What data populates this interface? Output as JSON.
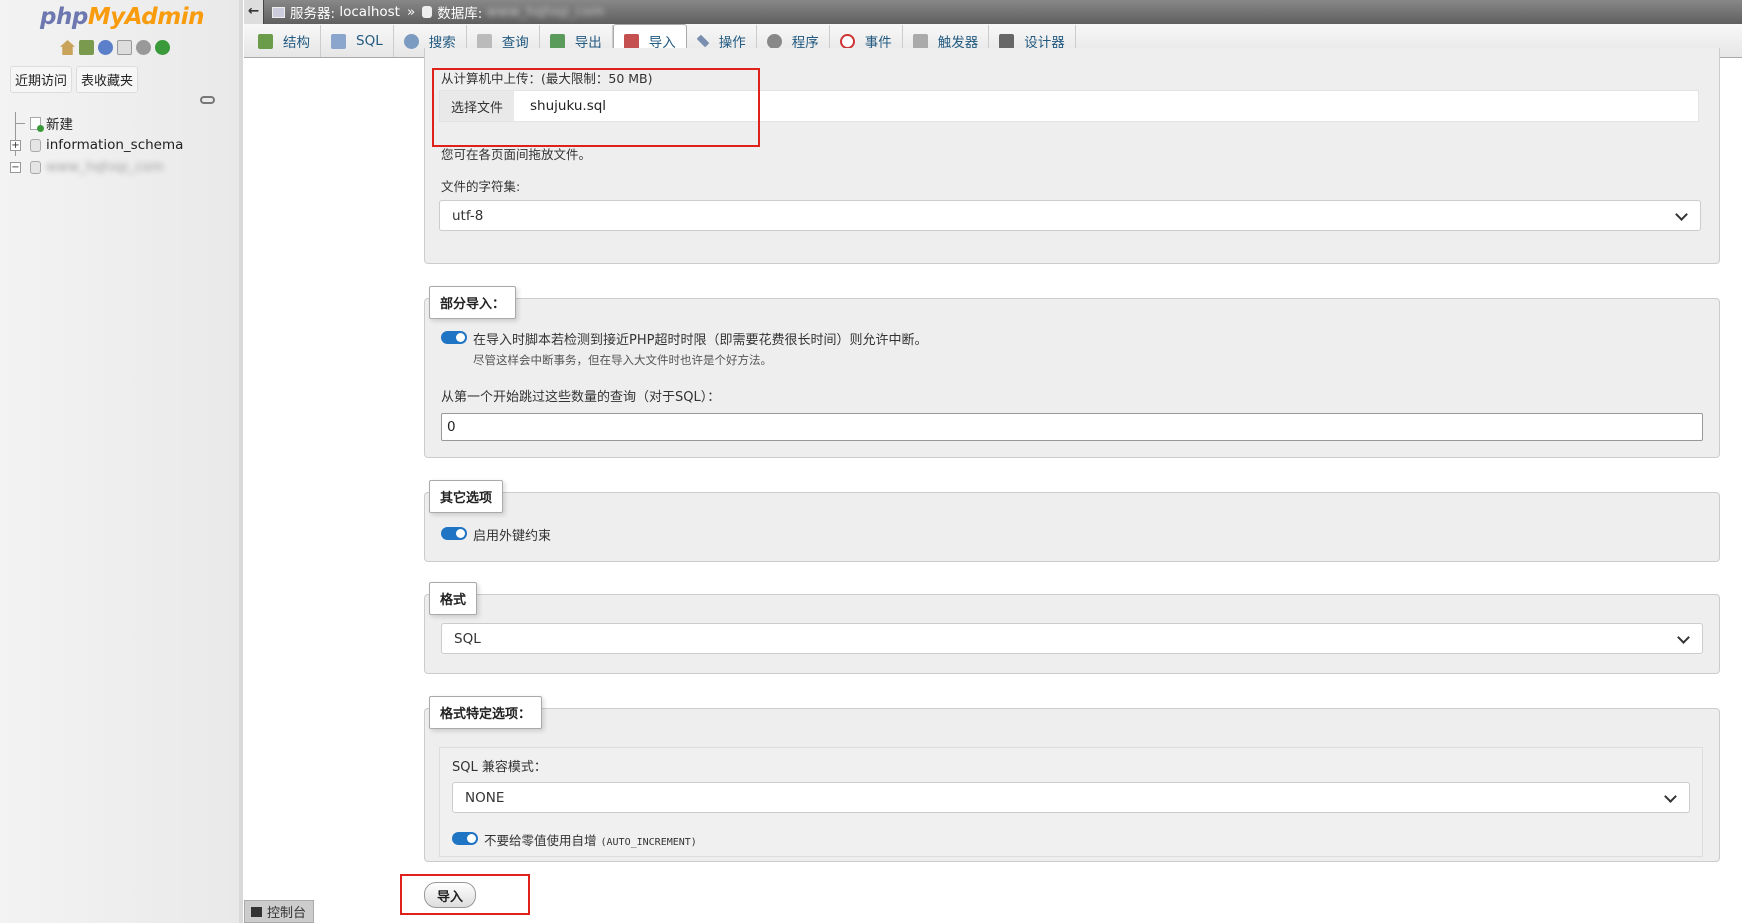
{
  "app": {
    "logo_php": "php",
    "logo_myadmin": "MyAdmin"
  },
  "nav": {
    "tabs": [
      "近期访问",
      "表收藏夹"
    ],
    "tree": [
      {
        "label": "新建"
      },
      {
        "label": "information_schema"
      },
      {
        "label": "www_hqhxp_com"
      }
    ]
  },
  "breadcrumb": {
    "server_label": "服务器:",
    "server": "localhost",
    "db_label": "数据库:",
    "db": "www_hqhxp_com"
  },
  "menu": {
    "tabs": [
      {
        "label": "结构",
        "icon": "structure-icon"
      },
      {
        "label": "SQL",
        "icon": "sql-icon"
      },
      {
        "label": "搜索",
        "icon": "search-icon"
      },
      {
        "label": "查询",
        "icon": "query-icon"
      },
      {
        "label": "导出",
        "icon": "export-icon"
      },
      {
        "label": "导入",
        "icon": "import-icon",
        "active": true
      },
      {
        "label": "操作",
        "icon": "wrench-icon"
      },
      {
        "label": "程序",
        "icon": "routines-icon"
      },
      {
        "label": "事件",
        "icon": "clock-icon"
      },
      {
        "label": "触发器",
        "icon": "trigger-icon"
      },
      {
        "label": "设计器",
        "icon": "designer-icon"
      }
    ]
  },
  "upload": {
    "title": "从计算机中上传：(最大限制：50 MB)",
    "choose_button": "选择文件",
    "file_name": "shujuku.sql",
    "drag_hint": "您可在各页面间拖放文件。",
    "charset_label": "文件的字符集:",
    "charset_value": "utf-8"
  },
  "partial": {
    "legend": "部分导入：",
    "allow_interrupt": "在导入时脚本若检测到接近PHP超时时限（即需要花费很长时间）则允许中断。",
    "allow_interrupt_note": "尽管这样会中断事务，但在导入大文件时也许是个好方法。",
    "skip_label": "从第一个开始跳过这些数量的查询（对于SQL）：",
    "skip_value": "0"
  },
  "other": {
    "legend": "其它选项",
    "foreign_keys": "启用外键约束"
  },
  "format": {
    "legend": "格式",
    "value": "SQL"
  },
  "format_options": {
    "legend": "格式特定选项：",
    "compat_label": "SQL 兼容模式：",
    "compat_value": "NONE",
    "auto_inc": "不要给零值使用自增",
    "auto_inc_code": "(AUTO_INCREMENT)"
  },
  "submit": {
    "label": "导入"
  },
  "console": {
    "label": "控制台"
  }
}
